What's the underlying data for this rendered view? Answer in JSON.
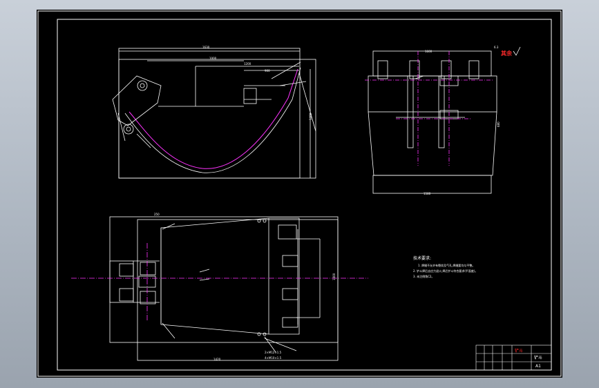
{
  "drawing": {
    "technical_requirements": {
      "title": "技术要求:",
      "lines": [
        "1. 焊缝不允许有裂纹及气孔,焊缝要均匀平整。",
        "2. 铲斗焊后去应力退火,焊后铲斗符合要求(平面度)。",
        "3. 未注倒角C2。"
      ]
    },
    "title_block": {
      "stamp": "铲斗",
      "part_name": "铲斗",
      "sheet_size": "A1"
    },
    "roughness_note": "其余"
  }
}
